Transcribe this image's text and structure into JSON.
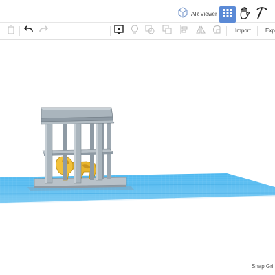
{
  "header": {
    "ar_viewer_label": "AR Viewer"
  },
  "toolbar": {
    "import_label": "Import",
    "export_label": "Expo"
  },
  "footer": {
    "snap_grid_label": "Snap Gri"
  },
  "colors": {
    "accent": "#5b8ad6",
    "grid_plane": "#4db8f0",
    "cage": "#aab5bd",
    "cage_dark": "#8e9aa4",
    "figure": "#f2c13a"
  },
  "icons": {
    "top": [
      "ar-viewer-icon",
      "grid-view-icon",
      "hand-icon",
      "pickaxe-icon"
    ],
    "toolbar": [
      "trash-icon",
      "undo-icon",
      "redo-icon",
      "notes-icon",
      "light-icon",
      "shape-icon",
      "copy-icon",
      "align-icon",
      "mirror-icon",
      "group-icon"
    ]
  }
}
